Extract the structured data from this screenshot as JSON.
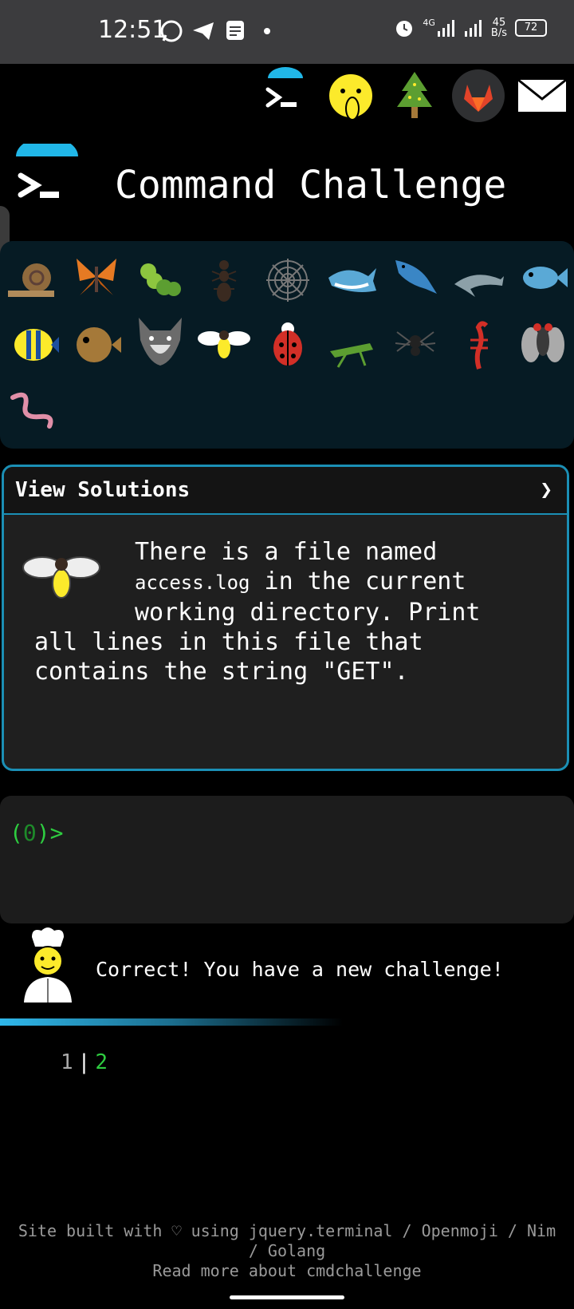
{
  "status_bar": {
    "time": "12:51",
    "network": "4G",
    "speed": "45\nB/s",
    "battery": "72",
    "icons": [
      "whatsapp-icon",
      "telegram-icon",
      "notes-icon",
      "dot-icon",
      "alarm-icon",
      "signal-icon",
      "signal-icon",
      "battery-icon"
    ]
  },
  "top_icons": [
    "terminal-icon",
    "shushing-face-icon",
    "tree-icon",
    "gitlab-icon",
    "envelope-icon"
  ],
  "header": {
    "title": "Command Challenge"
  },
  "animals": [
    "snail",
    "butterfly",
    "caterpillar",
    "ant",
    "spider-web",
    "whale",
    "whale",
    "dolphin",
    "fish",
    "tropical-fish",
    "blowfish",
    "wolf",
    "honeybee",
    "lady-beetle",
    "cricket",
    "spider",
    "scorpion",
    "fly",
    "worm"
  ],
  "solutions": {
    "title": "View Solutions",
    "chevron": "❯",
    "line1": "There is a file named",
    "code": "access.log",
    "line2": " in the current",
    "line3": "working directory. Print",
    "line4": "all lines in this file that",
    "line5": "contains the string \"GET\"."
  },
  "terminal": {
    "prompt_open": "(",
    "prompt_num": "0",
    "prompt_close": ")>"
  },
  "message": {
    "text": "Correct! You have a new challenge!"
  },
  "progress": {
    "fraction": 0.6
  },
  "pagination": {
    "page1": "1",
    "sep": "|",
    "page2": "2"
  },
  "footer": {
    "line1": "Site built with ♡ using jquery.terminal / Openmoji / Nim",
    "line2": "/ Golang",
    "line3": "Read more about cmdchallenge"
  }
}
